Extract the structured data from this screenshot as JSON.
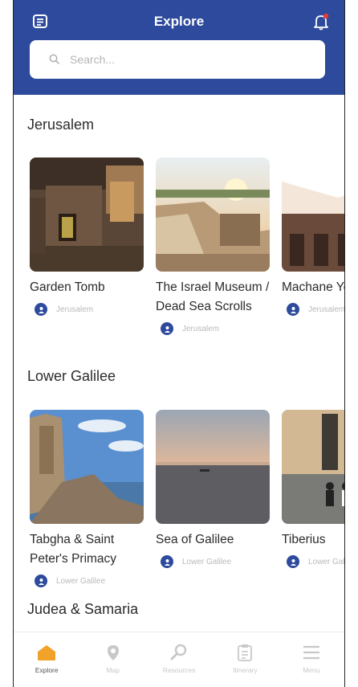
{
  "header": {
    "title": "Explore",
    "left_icon": "document-icon",
    "right_icon": "bell-icon",
    "search_placeholder": "Search..."
  },
  "sections": [
    {
      "title": "Jerusalem",
      "cards": [
        {
          "title": "Garden Tomb",
          "location": "Jerusalem"
        },
        {
          "title": "The Israel Museum / Dead Sea Scrolls",
          "location": "Jerusalem"
        },
        {
          "title": "Machane Yehuda",
          "location": "Jerusalem"
        }
      ]
    },
    {
      "title": "Lower Galilee",
      "cards": [
        {
          "title": "Tabgha & Saint Peter's Primacy",
          "location": "Lower Galilee"
        },
        {
          "title": "Sea of Galilee",
          "location": "Lower Galilee"
        },
        {
          "title": "Tiberius",
          "location": "Lower Galilee"
        }
      ]
    },
    {
      "title": "Judea & Samaria",
      "cards": []
    }
  ],
  "tabbar": [
    {
      "label": "Explore",
      "icon": "home-icon",
      "active": true
    },
    {
      "label": "Map",
      "icon": "map-pin-icon",
      "active": false
    },
    {
      "label": "Resources",
      "icon": "magnifier-icon",
      "active": false
    },
    {
      "label": "Itinerary",
      "icon": "clipboard-icon",
      "active": false
    },
    {
      "label": "Menu",
      "icon": "menu-icon",
      "active": false
    }
  ],
  "colors": {
    "brand": "#2d4a9c",
    "active_tab": "#f0a22a",
    "inactive_tab": "#c8c8c8"
  }
}
